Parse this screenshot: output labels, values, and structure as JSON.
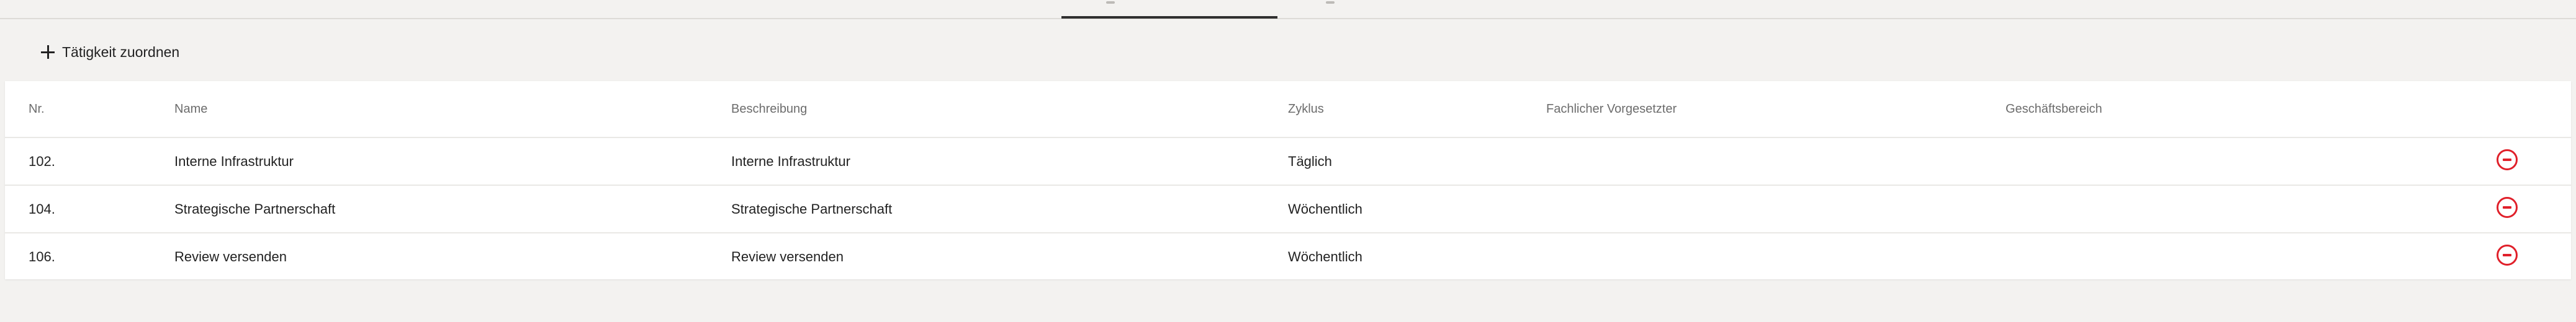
{
  "toolbar": {
    "assign_label": "Tätigkeit zuordnen"
  },
  "table": {
    "columns": {
      "nr": "Nr.",
      "name": "Name",
      "description": "Beschreibung",
      "cycle": "Zyklus",
      "supervisor": "Fachlicher Vorgesetzter",
      "business_area": "Geschäftsbereich"
    },
    "rows": [
      {
        "nr": "102.",
        "name": "Interne Infrastruktur",
        "description": "Interne Infrastruktur",
        "cycle": "Täglich",
        "supervisor": "",
        "business_area": ""
      },
      {
        "nr": "104.",
        "name": "Strategische Partnerschaft",
        "description": "Strategische Partnerschaft",
        "cycle": "Wöchentlich",
        "supervisor": "",
        "business_area": ""
      },
      {
        "nr": "106.",
        "name": "Review versenden",
        "description": "Review versenden",
        "cycle": "Wöchentlich",
        "supervisor": "",
        "business_area": ""
      }
    ]
  },
  "colors": {
    "accent_remove": "#e0202a",
    "tab_indicator": "#2f2f2f",
    "background": "#f3f2f0"
  },
  "icons": {
    "add": "plus-icon",
    "remove": "minus-circle-icon"
  }
}
